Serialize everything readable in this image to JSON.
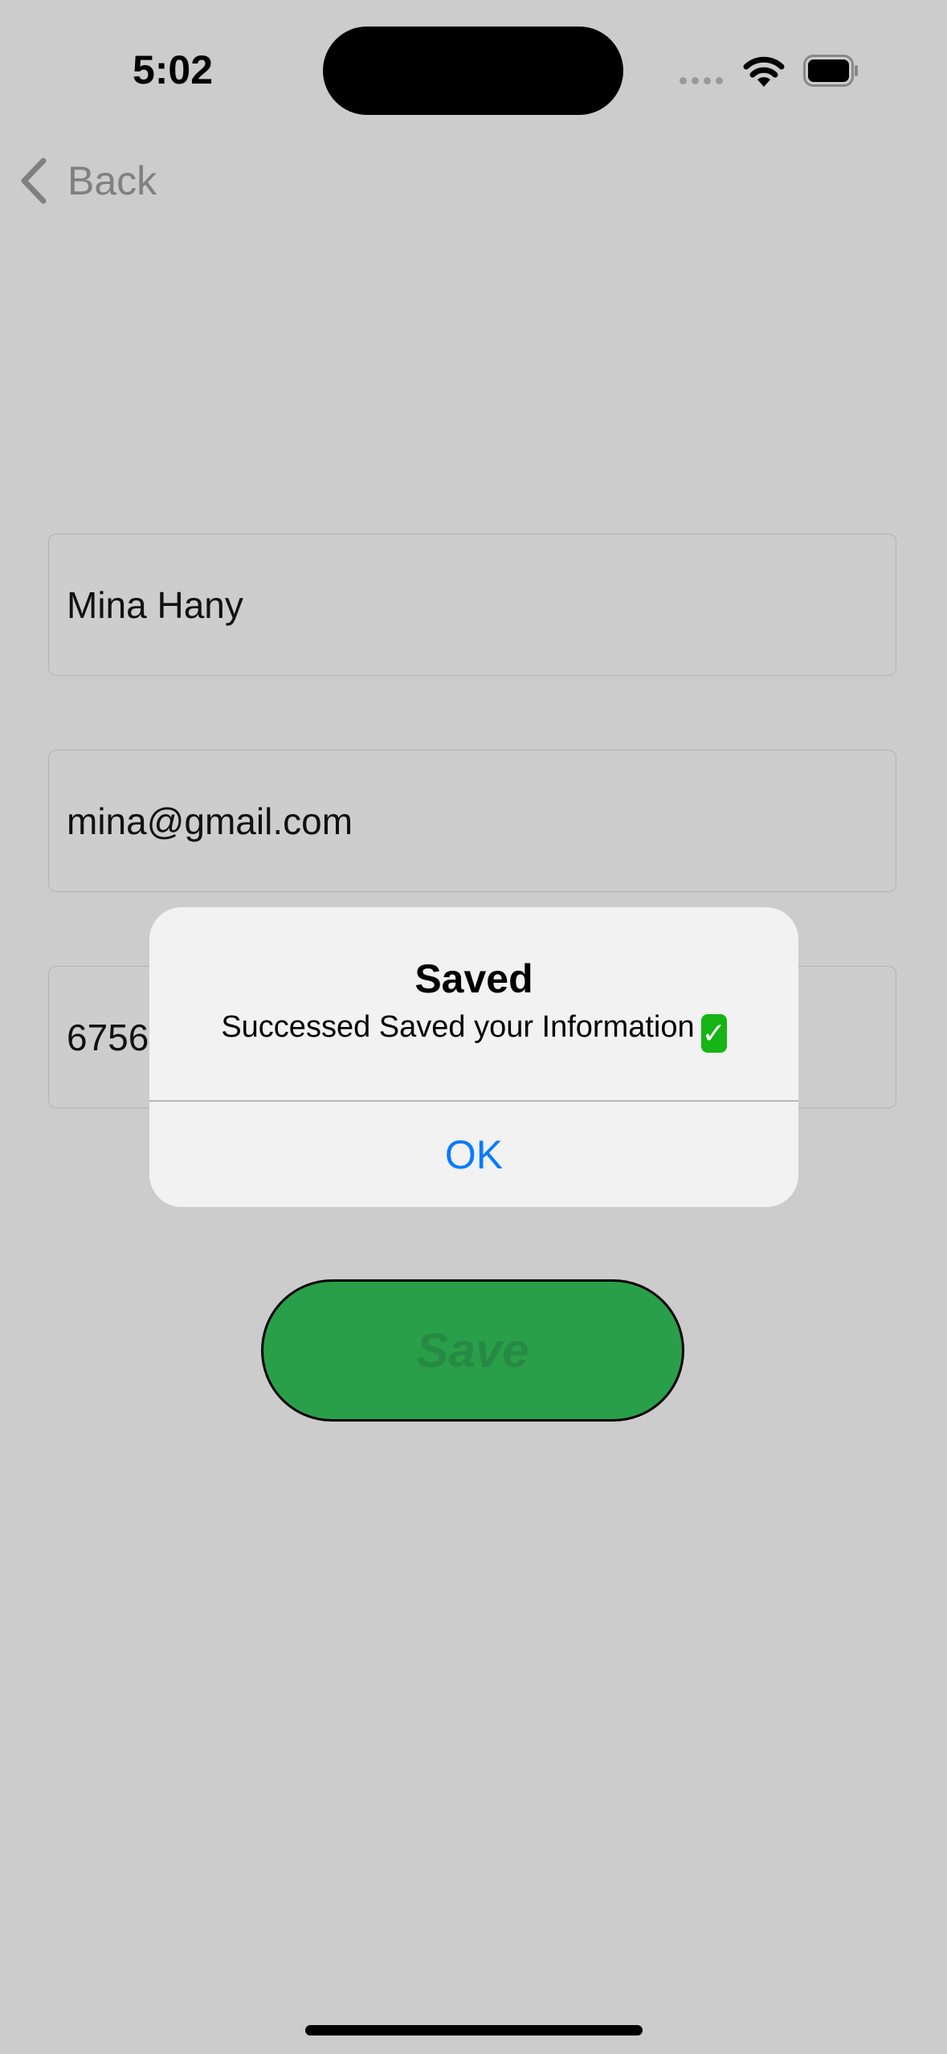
{
  "status_bar": {
    "time": "5:02",
    "icons": [
      "signal-icon",
      "wifi-icon",
      "battery-icon"
    ]
  },
  "nav": {
    "back_label": "Back",
    "icon": "chevron-left-icon"
  },
  "form": {
    "name_value": "Mina Hany",
    "email_value": "mina@gmail.com",
    "phone_value": "6756"
  },
  "alert": {
    "title": "Saved",
    "message": "Successed Saved your Information",
    "message_emoji": "✓",
    "ok_label": "OK"
  },
  "save_button": {
    "label": "Save"
  },
  "colors": {
    "accent": "#0a7aff",
    "save_green": "#2a9f49",
    "background": "#cccccc"
  }
}
